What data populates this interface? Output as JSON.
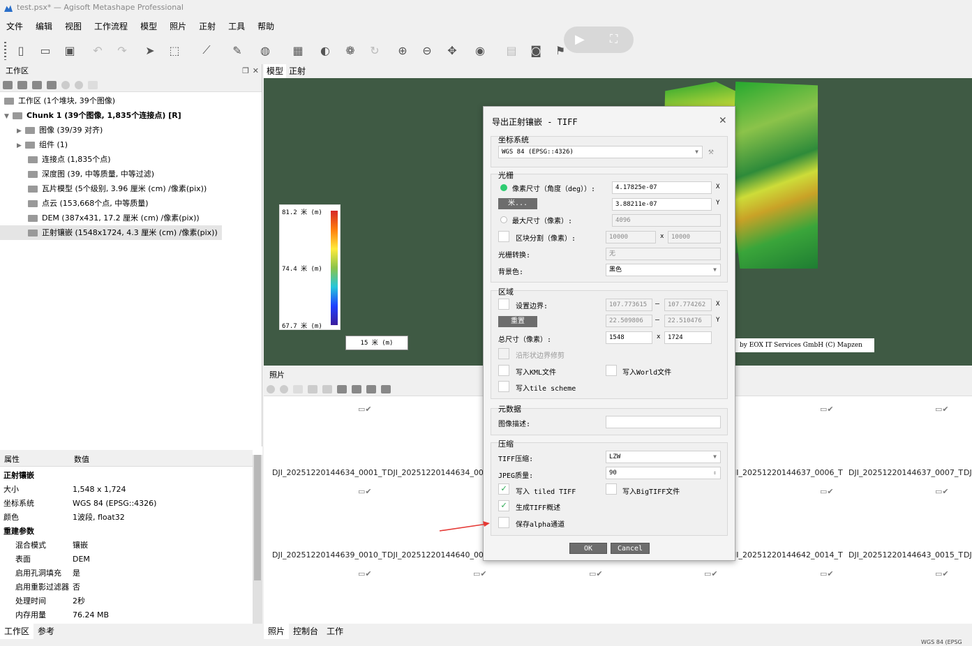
{
  "window": {
    "title": "test.psx* — Agisoft Metashape Professional"
  },
  "menu": [
    "文件",
    "编辑",
    "视图",
    "工作流程",
    "模型",
    "照片",
    "正射",
    "工具",
    "帮助"
  ],
  "workspace": {
    "title": "工作区",
    "tree": [
      {
        "label": "工作区 (1个堆块, 39个图像)",
        "icon": "workspace-icon"
      },
      {
        "label": "Chunk 1 (39个图像, 1,835个连接点) [R]",
        "icon": "chunk-icon",
        "bold": true
      },
      {
        "label": "图像 (39/39 对齐)",
        "icon": "folder-icon"
      },
      {
        "label": "组件 (1)",
        "icon": "folder-icon"
      },
      {
        "label": "连接点 (1,835个点)",
        "icon": "tie-points-icon"
      },
      {
        "label": "深度图 (39, 中等质量, 中等过滤)",
        "icon": "depth-map-icon"
      },
      {
        "label": "瓦片模型 (5个级别, 3.96 厘米 (cm) /像素(pix))",
        "icon": "tiled-model-icon"
      },
      {
        "label": "点云 (153,668个点, 中等质量)",
        "icon": "point-cloud-icon"
      },
      {
        "label": "DEM (387x431, 17.2 厘米 (cm) /像素(pix))",
        "icon": "dem-icon"
      },
      {
        "label": "正射镶嵌 (1548x1724, 4.3 厘米 (cm) /像素(pix))",
        "icon": "orthomosaic-icon"
      }
    ]
  },
  "properties": {
    "col_prop": "属性",
    "col_value": "数值",
    "rows": [
      {
        "k": "正射镶嵌",
        "v": "",
        "type": "grp"
      },
      {
        "k": "大小",
        "v": "1,548 x 1,724",
        "type": "row"
      },
      {
        "k": "坐标系统",
        "v": "WGS 84 (EPSG::4326)",
        "type": "row"
      },
      {
        "k": "颜色",
        "v": "1波段, float32",
        "type": "row"
      },
      {
        "k": "重建参数",
        "v": "",
        "type": "grp"
      },
      {
        "k": "混合模式",
        "v": "镶嵌",
        "type": "sub"
      },
      {
        "k": "表面",
        "v": "DEM",
        "type": "sub"
      },
      {
        "k": "启用孔洞填充",
        "v": "是",
        "type": "sub"
      },
      {
        "k": "启用重影过滤器",
        "v": "否",
        "type": "sub"
      },
      {
        "k": "处理时间",
        "v": "2秒",
        "type": "sub"
      },
      {
        "k": "内存用量",
        "v": "76.24 MB",
        "type": "sub"
      }
    ]
  },
  "left_tabs": [
    "工作区",
    "参考"
  ],
  "view_tabs": [
    "模型",
    "正射"
  ],
  "legend": {
    "top": "81.2 米 (m)",
    "mid": "74.4 米 (m)",
    "bottom": "67.7 米 (m)"
  },
  "scalebar": "15 米 (m)",
  "credit": "by EOX IT Services GmbH (C) Mapzen",
  "photos": {
    "title": "照片",
    "row1": [
      "DJI_20251220144634_0001_T",
      "DJI_20251220144634_0003",
      "JI_20251220144637_0006_T",
      "DJI_20251220144637_0007_T",
      "DJ"
    ],
    "row2": [
      "DJI_20251220144639_0010_T",
      "DJI_20251220144640_0011",
      "JI_20251220144642_0014_T",
      "DJI_20251220144643_0015_T",
      "DJ"
    ]
  },
  "right_tabs": [
    "照片",
    "控制台",
    "工作"
  ],
  "status": "WGS 84 (EPSG",
  "dialog": {
    "title": "导出正射镶嵌 - TIFF",
    "crs_group": "坐标系统",
    "crs_value": "WGS 84 (EPSG::4326)",
    "raster_group": "光栅",
    "pixel_size_label": "像素尺寸（角度（deg））:",
    "pixel_x": "4.17825e-07",
    "pixel_y": "3.88211e-07",
    "meters_btn": "米...",
    "max_size_label": "最大尺寸（像素）:",
    "max_size": "4096",
    "split_label": "区块分割（像素）:",
    "split_x": "10000",
    "split_y": "10000",
    "raster_transform_label": "光栅转换:",
    "raster_transform": "无",
    "background_label": "背景色:",
    "background": "黑色",
    "region_group": "区域",
    "set_bounds_label": "设置边界:",
    "bx1": "107.773615",
    "bx2": "107.774262",
    "by1": "22.509806",
    "by2": "22.510476",
    "reset_btn": "重置",
    "total_size_label": "总尺寸（像素）:",
    "total_w": "1548",
    "total_h": "1724",
    "clip_shape": "沿形状边界修剪",
    "write_kml": "写入KML文件",
    "write_world": "写入World文件",
    "write_tile": "写入tile scheme",
    "meta_group": "元数据",
    "img_desc_label": "图像描述:",
    "img_desc": "",
    "comp_group": "压缩",
    "tiff_comp_label": "TIFF压缩:",
    "tiff_comp": "LZW",
    "jpeg_q_label": "JPEG质量:",
    "jpeg_q": "90",
    "tiled_tiff": "写入 tiled TIFF",
    "bigtiff": "写入BigTIFF文件",
    "overview": "生成TIFF概述",
    "alpha": "保存alpha通道",
    "ok": "OK",
    "cancel": "Cancel",
    "x": "X",
    "y": "Y",
    "times": "x",
    "dash": "–"
  }
}
